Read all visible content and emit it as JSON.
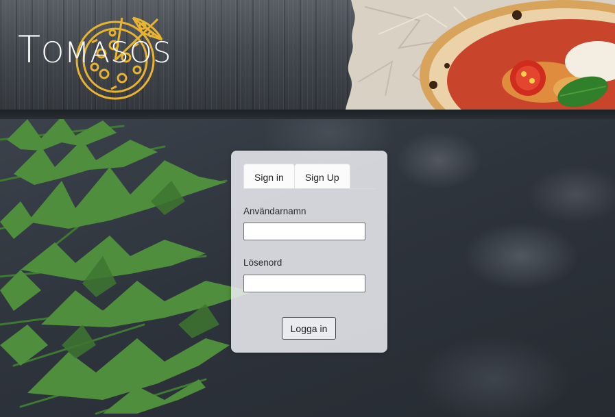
{
  "brand": {
    "logo_text_initial": "T",
    "logo_text_rest": "OMASOS",
    "accent_color": "#e8b330"
  },
  "auth": {
    "tabs": [
      {
        "label": "Sign in",
        "active": true
      },
      {
        "label": "Sign Up",
        "active": false
      }
    ],
    "username_label": "Användarnamn",
    "username_value": "",
    "password_label": "Lösenord",
    "password_value": "",
    "submit_label": "Logga in"
  },
  "icons": {
    "logo": "pizza-icon"
  }
}
